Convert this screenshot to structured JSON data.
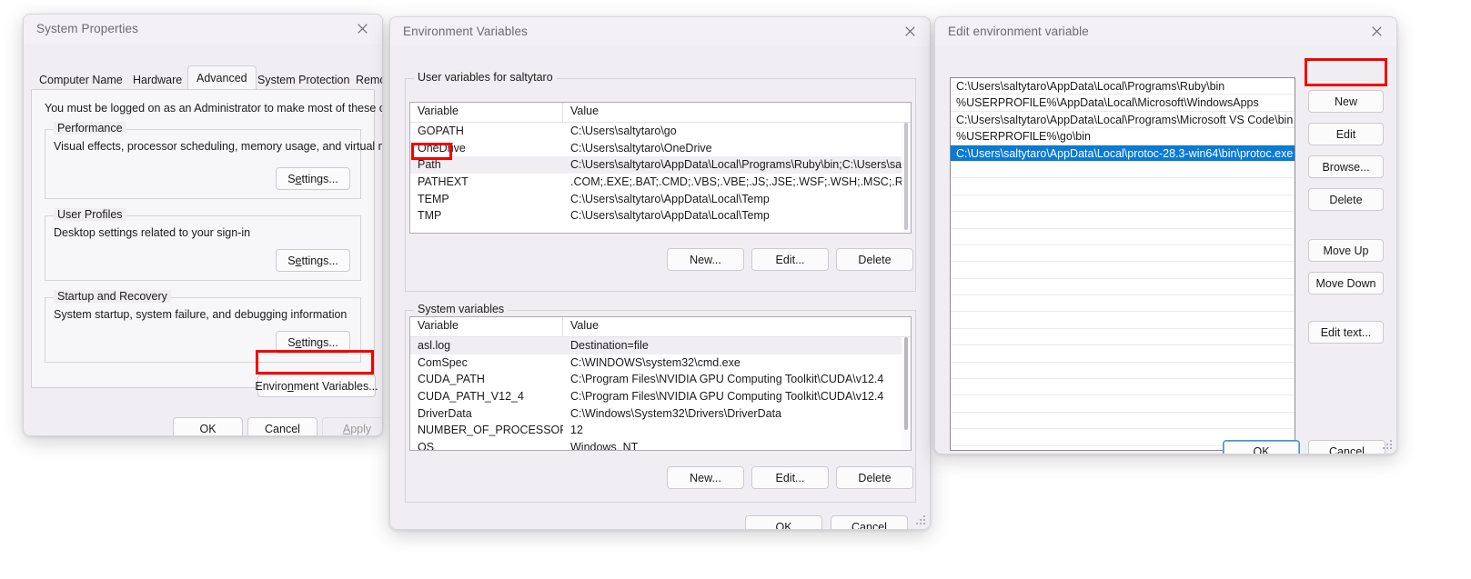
{
  "colors": {
    "annotation": "#f50000",
    "selection": "#0a7ad4",
    "window_bg": "#f0eef2",
    "field_bg": "#ffffff",
    "default_button_border": "#4a93c9"
  },
  "system_properties": {
    "title": "System Properties",
    "close_icon": "close-icon",
    "tabs": [
      {
        "label": "Computer Name",
        "active": false
      },
      {
        "label": "Hardware",
        "active": false
      },
      {
        "label": "Advanced",
        "active": true
      },
      {
        "label": "System Protection",
        "active": false
      },
      {
        "label": "Remote",
        "active": false
      }
    ],
    "admin_notice": "You must be logged on as an Administrator to make most of these changes.",
    "groups": [
      {
        "legend": "Performance",
        "description": "Visual effects, processor scheduling, memory usage, and virtual memory",
        "button": "Settings..."
      },
      {
        "legend": "User Profiles",
        "description": "Desktop settings related to your sign-in",
        "button": "Settings..."
      },
      {
        "legend": "Startup and Recovery",
        "description": "System startup, system failure, and debugging information",
        "button": "Settings..."
      }
    ],
    "environment_variables_button": "Environment Variables...",
    "footer_buttons": [
      {
        "label": "OK",
        "disabled": false
      },
      {
        "label": "Cancel",
        "disabled": false
      },
      {
        "label": "Apply",
        "disabled": true
      }
    ]
  },
  "environment_variables": {
    "title": "Environment Variables",
    "close_icon": "close-icon",
    "user_section": {
      "legend": "User variables for saltytaro",
      "columns": [
        "Variable",
        "Value"
      ],
      "rows": [
        {
          "variable": "GOPATH",
          "value": "C:\\Users\\saltytaro\\go",
          "selected": false
        },
        {
          "variable": "OneDrive",
          "value": "C:\\Users\\saltytaro\\OneDrive",
          "selected": false
        },
        {
          "variable": "Path",
          "value": "C:\\Users\\saltytaro\\AppData\\Local\\Programs\\Ruby\\bin;C:\\Users\\sal...",
          "selected": true
        },
        {
          "variable": "PATHEXT",
          "value": ".COM;.EXE;.BAT;.CMD;.VBS;.VBE;.JS;.JSE;.WSF;.WSH;.MSC;.RB;.RBW;....",
          "selected": false
        },
        {
          "variable": "TEMP",
          "value": "C:\\Users\\saltytaro\\AppData\\Local\\Temp",
          "selected": false
        },
        {
          "variable": "TMP",
          "value": "C:\\Users\\saltytaro\\AppData\\Local\\Temp",
          "selected": false
        }
      ],
      "buttons": [
        "New...",
        "Edit...",
        "Delete"
      ]
    },
    "system_section": {
      "legend": "System variables",
      "columns": [
        "Variable",
        "Value"
      ],
      "rows": [
        {
          "variable": "asl.log",
          "value": "Destination=file",
          "selected": true
        },
        {
          "variable": "ComSpec",
          "value": "C:\\WINDOWS\\system32\\cmd.exe",
          "selected": false
        },
        {
          "variable": "CUDA_PATH",
          "value": "C:\\Program Files\\NVIDIA GPU Computing Toolkit\\CUDA\\v12.4",
          "selected": false
        },
        {
          "variable": "CUDA_PATH_V12_4",
          "value": "C:\\Program Files\\NVIDIA GPU Computing Toolkit\\CUDA\\v12.4",
          "selected": false
        },
        {
          "variable": "DriverData",
          "value": "C:\\Windows\\System32\\Drivers\\DriverData",
          "selected": false
        },
        {
          "variable": "NUMBER_OF_PROCESSORS",
          "value": "12",
          "selected": false
        },
        {
          "variable": "OS",
          "value": "Windows_NT",
          "selected": false
        }
      ],
      "buttons": [
        "New...",
        "Edit...",
        "Delete"
      ]
    },
    "footer_buttons": [
      {
        "label": "OK",
        "disabled": false
      },
      {
        "label": "Cancel",
        "disabled": false
      }
    ]
  },
  "edit_environment_variable": {
    "title": "Edit environment variable",
    "close_icon": "close-icon",
    "entries": [
      {
        "path": "C:\\Users\\saltytaro\\AppData\\Local\\Programs\\Ruby\\bin",
        "selected": false
      },
      {
        "path": "%USERPROFILE%\\AppData\\Local\\Microsoft\\WindowsApps",
        "selected": false
      },
      {
        "path": "C:\\Users\\saltytaro\\AppData\\Local\\Programs\\Microsoft VS Code\\bin",
        "selected": false
      },
      {
        "path": "%USERPROFILE%\\go\\bin",
        "selected": false
      },
      {
        "path": "C:\\Users\\saltytaro\\AppData\\Local\\protoc-28.3-win64\\bin\\protoc.exe",
        "selected": true
      }
    ],
    "side_buttons": [
      {
        "label": "New",
        "highlighted": true
      },
      {
        "label": "Edit",
        "highlighted": false
      },
      {
        "label": "Browse...",
        "highlighted": false
      },
      {
        "label": "Delete",
        "highlighted": false
      },
      {
        "label": "Move Up",
        "highlighted": false
      },
      {
        "label": "Move Down",
        "highlighted": false
      },
      {
        "label": "Edit text...",
        "highlighted": false
      }
    ],
    "footer_buttons": [
      {
        "label": "OK",
        "default": true
      },
      {
        "label": "Cancel",
        "default": false
      }
    ]
  },
  "annotations": [
    {
      "name": "environment-variables-button-highlight"
    },
    {
      "name": "path-row-highlight"
    },
    {
      "name": "new-button-highlight"
    }
  ]
}
